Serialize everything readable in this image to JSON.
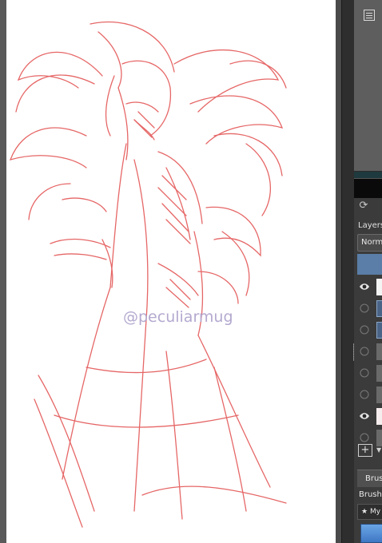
{
  "canvas": {
    "watermark": "@peculiarmug",
    "sketch_color": "#e24c4c",
    "background_color": "#ffffff"
  },
  "dock": {
    "preview_icon": "panel-list-icon",
    "layers_title": "Layers",
    "blend_mode": "Norma",
    "add_layer_icon": "plus-square-icon",
    "brush_tab": "Brush",
    "brush_label": "Brush",
    "preset_prefix": "★",
    "preset_label": "My",
    "accent_color": "#5a7ea7"
  },
  "layers": [
    {
      "visible": true,
      "thumb": "white"
    },
    {
      "visible": false,
      "thumb": "blue"
    },
    {
      "visible": false,
      "thumb": "blue"
    },
    {
      "visible": false,
      "thumb": "gray"
    },
    {
      "visible": false,
      "thumb": "gray"
    },
    {
      "visible": false,
      "thumb": "gray"
    },
    {
      "visible": true,
      "thumb": "sketch"
    },
    {
      "visible": false,
      "thumb": "gray"
    }
  ]
}
